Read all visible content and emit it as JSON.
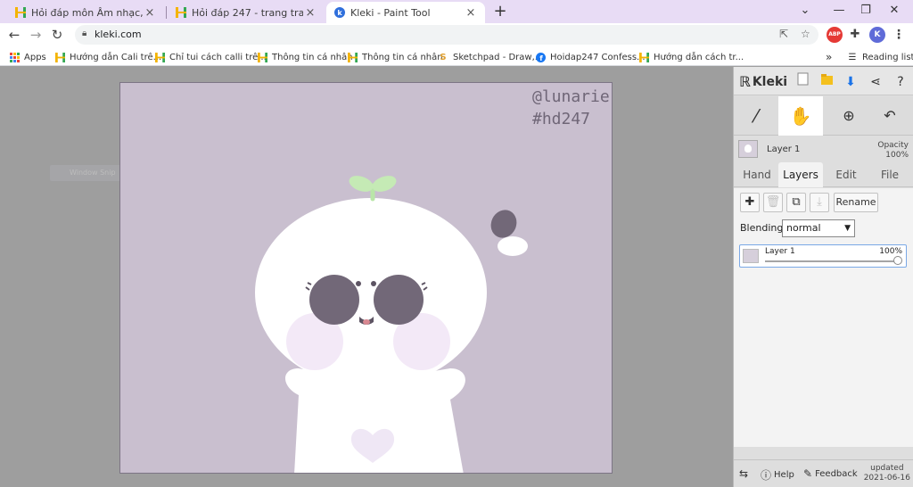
{
  "browser": {
    "tabs": [
      {
        "title": "Hỏi đáp môn Âm nhạc, Mỹ thuật",
        "favicon": "hoidap-icon"
      },
      {
        "title": "Hỏi đáp 247 - trang tra loi",
        "favicon": "hoidap-icon"
      },
      {
        "title": "Kleki - Paint Tool",
        "favicon": "kleki-icon"
      }
    ],
    "new_tab": "+",
    "url": "kleki.com",
    "profile_initial": "K",
    "abp": "ABP",
    "bookmarks": [
      {
        "label": "Apps",
        "icon": "apps-grid-icon"
      },
      {
        "label": "Hướng dẫn Cali trê...",
        "icon": "hoidap-icon"
      },
      {
        "label": "Chỉ tui cách calli trê...",
        "icon": "hoidap-icon"
      },
      {
        "label": "Thông tin cá nhân",
        "icon": "hoidap-icon"
      },
      {
        "label": "Thông tin cá nhân",
        "icon": "hoidap-icon"
      },
      {
        "label": "Sketchpad - Draw,...",
        "icon": "sketchpad-icon"
      },
      {
        "label": "Hoidap247 Confess...",
        "icon": "facebook-icon"
      },
      {
        "label": "Hướng dẫn cách tr...",
        "icon": "hoidap-icon"
      }
    ],
    "reading_list": "Reading list",
    "more_bookmarks": "»"
  },
  "canvas": {
    "watermark_line1": "@lunarie",
    "watermark_line2": "#hd247",
    "background_color": "#c9bfcf"
  },
  "ghost_snip": "Window Snip",
  "panel": {
    "logo": "Kleki",
    "layer_name": "Layer 1",
    "opacity_label": "Opacity",
    "opacity_value": "100%",
    "tabs": [
      "Hand",
      "Layers",
      "Edit",
      "File"
    ],
    "active_tab": "Layers",
    "rename": "Rename",
    "blending_label": "Blending",
    "blending_value": "normal",
    "layers": [
      {
        "name": "Layer 1",
        "opacity": "100%"
      }
    ],
    "footer": {
      "help": "Help",
      "feedback": "Feedback",
      "updated_label": "updated",
      "updated_date": "2021-06-16"
    }
  },
  "colors": {
    "accent": "#1a73e8",
    "tabstrip": "#e8dcf5",
    "hoidap_yellow": "#f4b400",
    "hoidap_green": "#34a853"
  }
}
